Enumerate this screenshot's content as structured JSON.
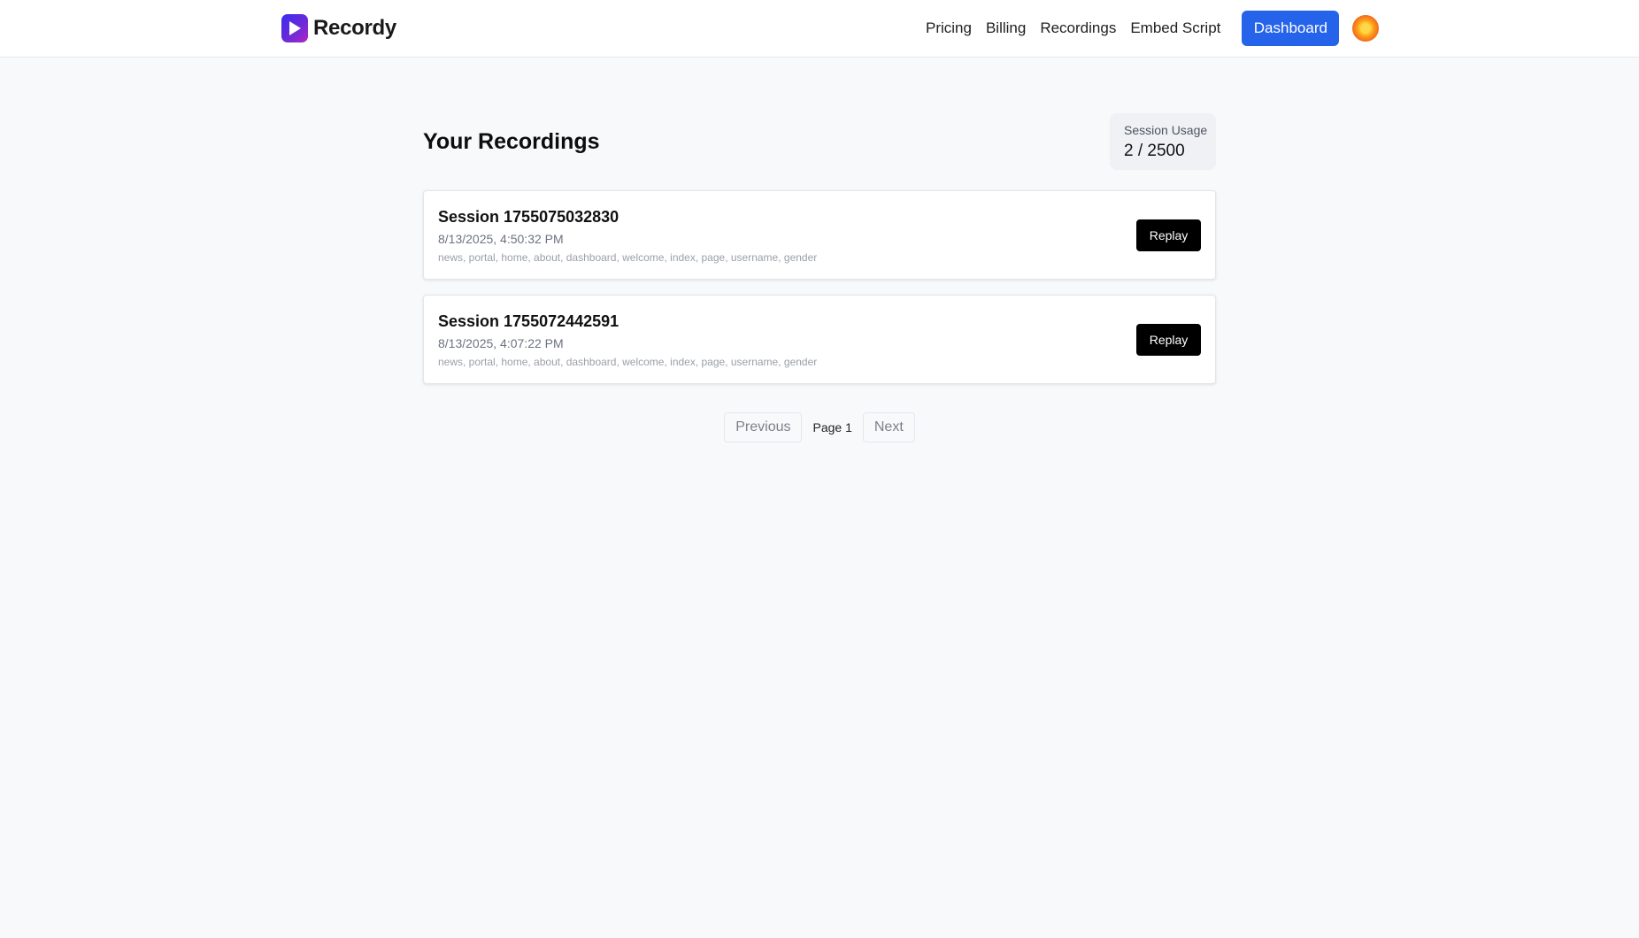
{
  "header": {
    "brand_name": "Recordy",
    "nav": [
      {
        "label": "Pricing"
      },
      {
        "label": "Billing"
      },
      {
        "label": "Recordings"
      },
      {
        "label": "Embed Script"
      }
    ],
    "dashboard_label": "Dashboard"
  },
  "page": {
    "title": "Your Recordings",
    "usage_label": "Session Usage",
    "usage_value": "2 / 2500"
  },
  "recordings": [
    {
      "title": "Session 1755075032830",
      "date": "8/13/2025, 4:50:32 PM",
      "tags": "news, portal, home, about, dashboard, welcome, index, page, username, gender",
      "action": "Replay"
    },
    {
      "title": "Session 1755072442591",
      "date": "8/13/2025, 4:07:22 PM",
      "tags": "news, portal, home, about, dashboard, welcome, index, page, username, gender",
      "action": "Replay"
    }
  ],
  "pagination": {
    "previous_label": "Previous",
    "page_label": "Page 1",
    "next_label": "Next"
  },
  "colors": {
    "primary": "#2563eb",
    "replay_button": "#000000",
    "background": "#f8f9fb"
  },
  "icons": {
    "brand": "play-icon",
    "avatar": "user-avatar"
  }
}
